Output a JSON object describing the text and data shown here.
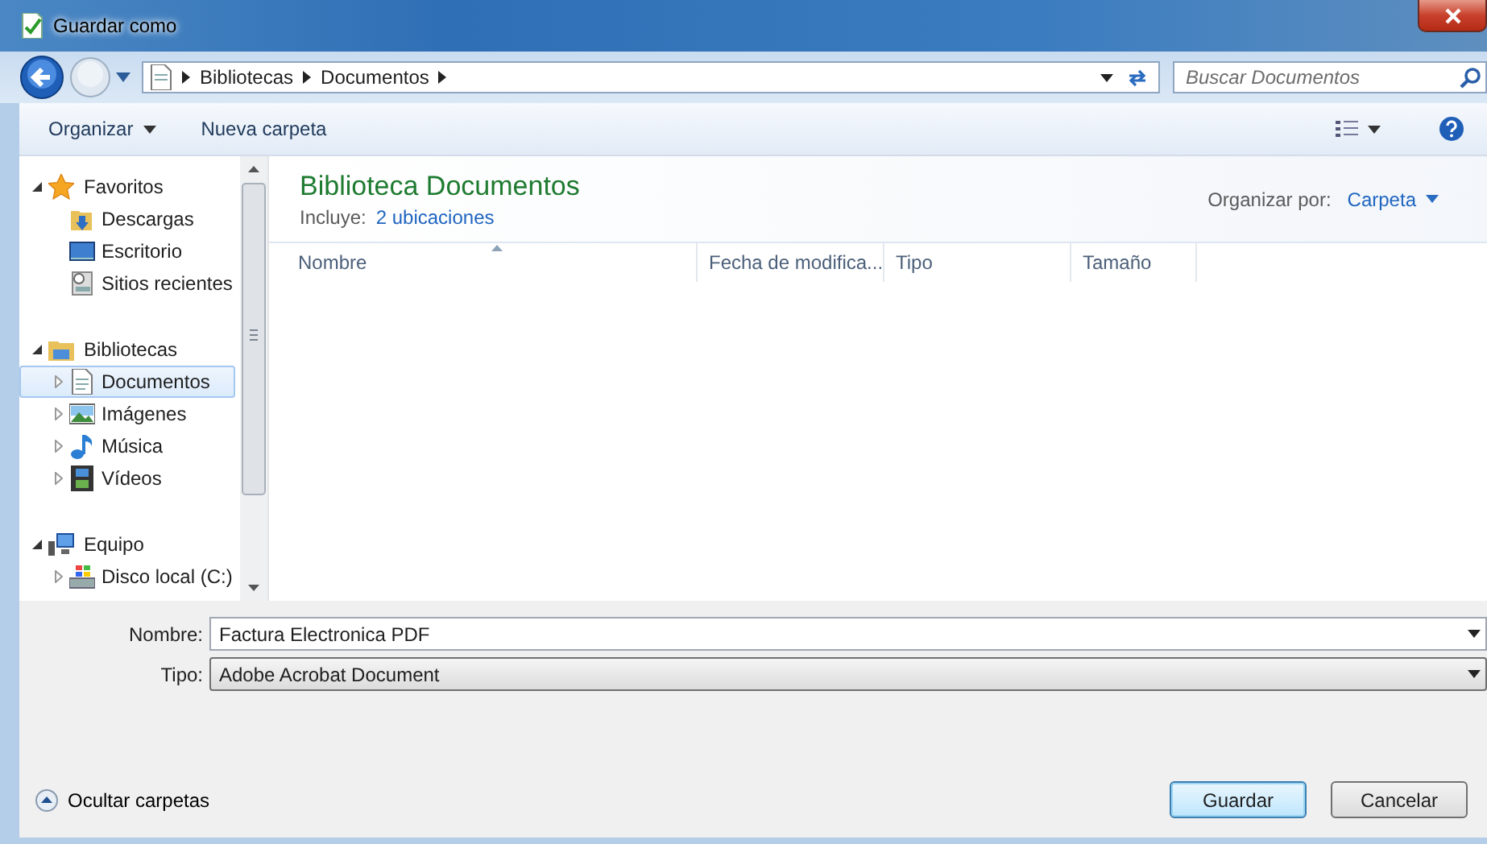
{
  "window": {
    "title": "Guardar como"
  },
  "address": {
    "breadcrumbs": [
      "Bibliotecas",
      "Documentos"
    ]
  },
  "search": {
    "placeholder": "Buscar Documentos"
  },
  "toolbar": {
    "items": [
      {
        "label": "Organizar",
        "kind": "menu"
      },
      {
        "label": "Nueva carpeta",
        "kind": "button"
      }
    ]
  },
  "sidebar": {
    "items": [
      {
        "label": "Favoritos",
        "kind": "star",
        "expanded": true,
        "selected": false,
        "children": [
          {
            "label": "Descargas",
            "kind": "downloads",
            "selected": false
          },
          {
            "label": "Escritorio",
            "kind": "desktop",
            "selected": false
          },
          {
            "label": "Sitios recientes",
            "kind": "recent",
            "selected": false
          }
        ]
      },
      {
        "label": "Bibliotecas",
        "kind": "library",
        "expanded": true,
        "selected": false,
        "children": [
          {
            "label": "Documentos",
            "kind": "document",
            "expanded": false,
            "selected": true
          },
          {
            "label": "Imágenes",
            "kind": "images",
            "expanded": false,
            "selected": false
          },
          {
            "label": "Música",
            "kind": "music",
            "expanded": false,
            "selected": false
          },
          {
            "label": "Vídeos",
            "kind": "video",
            "expanded": false,
            "selected": false
          }
        ]
      },
      {
        "label": "Equipo",
        "kind": "computer",
        "expanded": true,
        "selected": false,
        "children": [
          {
            "label": "Disco local (C:)",
            "kind": "drive",
            "expanded": false,
            "selected": false
          }
        ]
      }
    ]
  },
  "library": {
    "title": "Biblioteca Documentos",
    "includes_label": "Incluye:",
    "includes_link": "2 ubicaciones",
    "arrange_label": "Organizar por:",
    "arrange_value": "Carpeta"
  },
  "table": {
    "columns": [
      {
        "label": "Nombre",
        "sorted": true
      },
      {
        "label": "Fecha de modifica...",
        "sorted": false
      },
      {
        "label": "Tipo",
        "sorted": false
      },
      {
        "label": "Tamaño",
        "sorted": false
      }
    ]
  },
  "form": {
    "fields": [
      {
        "label": "Nombre:",
        "value": "Factura Electronica PDF",
        "kind": "combo"
      },
      {
        "label": "Tipo:",
        "value": "Adobe Acrobat Document",
        "kind": "select"
      }
    ]
  },
  "footer": {
    "toggle": "Ocultar carpetas",
    "buttons": [
      {
        "label": "Guardar",
        "default": true
      },
      {
        "label": "Cancelar",
        "default": false
      }
    ]
  }
}
